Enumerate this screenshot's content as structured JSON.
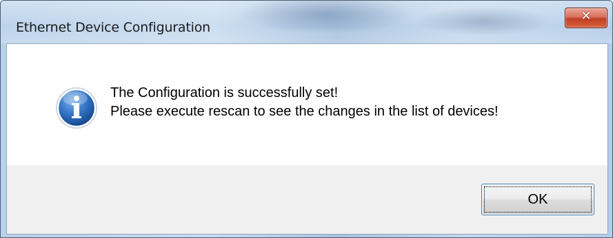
{
  "window": {
    "title": "Ethernet Device Configuration"
  },
  "titlebar": {
    "close_icon": "close-icon"
  },
  "message": {
    "icon": "info-icon",
    "line1": "The Configuration is successfully set!",
    "line2": "Please execute rescan to see the changes in the list of devices!"
  },
  "buttons": {
    "ok_label": "OK"
  },
  "colors": {
    "close_button": "#c9472d",
    "info_icon": "#1d5fb0",
    "focus_border": "#3c7fb1"
  }
}
